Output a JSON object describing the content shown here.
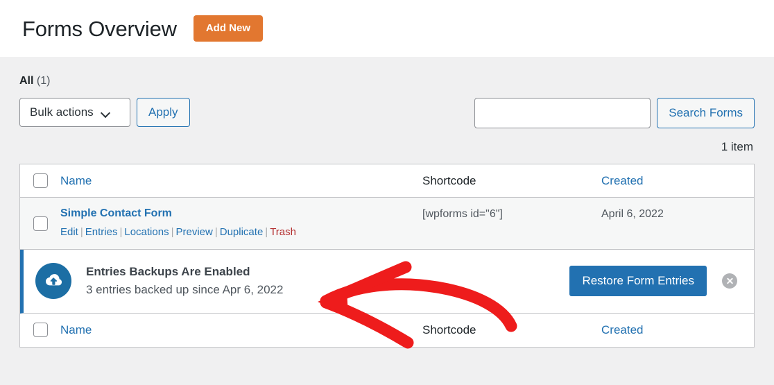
{
  "header": {
    "title": "Forms Overview",
    "add_new_label": "Add New"
  },
  "filters": {
    "all_label": "All",
    "all_count": "(1)",
    "bulk_actions_label": "Bulk actions",
    "apply_label": "Apply",
    "search_value": "",
    "search_placeholder": "",
    "search_button_label": "Search Forms",
    "item_count_label": "1 item"
  },
  "table": {
    "columns": {
      "checkbox": "select-all",
      "name": "Name",
      "shortcode": "Shortcode",
      "created": "Created"
    },
    "rows": [
      {
        "name": "Simple Contact Form",
        "shortcode": "[wpforms id=\"6\"]",
        "created": "April 6, 2022",
        "actions": [
          {
            "label": "Edit",
            "style": "link"
          },
          {
            "label": "Entries",
            "style": "link"
          },
          {
            "label": "Locations",
            "style": "link"
          },
          {
            "label": "Preview",
            "style": "link"
          },
          {
            "label": "Duplicate",
            "style": "link"
          },
          {
            "label": "Trash",
            "style": "danger"
          }
        ],
        "action_separator": "|"
      }
    ],
    "footer_columns": {
      "name": "Name",
      "shortcode": "Shortcode",
      "created": "Created"
    }
  },
  "notice": {
    "icon": "cloud-upload-icon",
    "title": "Entries Backups Are Enabled",
    "subtitle": "3 entries backed up since Apr 6, 2022",
    "button_label": "Restore Form Entries",
    "dismiss_icon": "close-icon",
    "accent_color": "#2271b1",
    "icon_bg_color": "#1c6ea4"
  },
  "annotation": {
    "type": "hand-drawn-arrow",
    "color": "#ee1c1c",
    "points_to": "notice-subtitle"
  },
  "colors": {
    "brand_orange": "#e27730",
    "link_blue": "#2271b1",
    "danger_red": "#b32d2e",
    "page_bg": "#f0f0f1"
  }
}
